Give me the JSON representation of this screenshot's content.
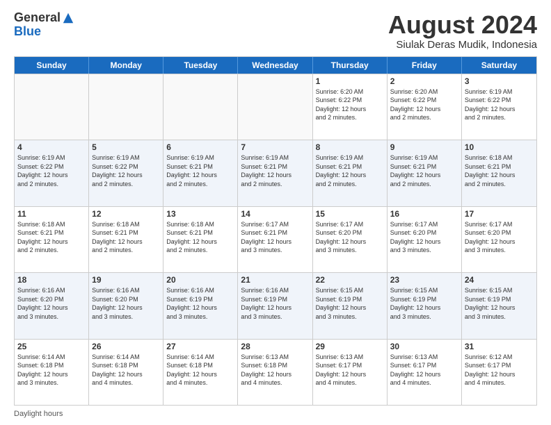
{
  "logo": {
    "general": "General",
    "blue": "Blue"
  },
  "title": "August 2024",
  "subtitle": "Siulak Deras Mudik, Indonesia",
  "days": [
    "Sunday",
    "Monday",
    "Tuesday",
    "Wednesday",
    "Thursday",
    "Friday",
    "Saturday"
  ],
  "footer": "Daylight hours",
  "weeks": [
    [
      {
        "day": "",
        "info": ""
      },
      {
        "day": "",
        "info": ""
      },
      {
        "day": "",
        "info": ""
      },
      {
        "day": "",
        "info": ""
      },
      {
        "day": "1",
        "info": "Sunrise: 6:20 AM\nSunset: 6:22 PM\nDaylight: 12 hours\nand 2 minutes."
      },
      {
        "day": "2",
        "info": "Sunrise: 6:20 AM\nSunset: 6:22 PM\nDaylight: 12 hours\nand 2 minutes."
      },
      {
        "day": "3",
        "info": "Sunrise: 6:19 AM\nSunset: 6:22 PM\nDaylight: 12 hours\nand 2 minutes."
      }
    ],
    [
      {
        "day": "4",
        "info": "Sunrise: 6:19 AM\nSunset: 6:22 PM\nDaylight: 12 hours\nand 2 minutes."
      },
      {
        "day": "5",
        "info": "Sunrise: 6:19 AM\nSunset: 6:22 PM\nDaylight: 12 hours\nand 2 minutes."
      },
      {
        "day": "6",
        "info": "Sunrise: 6:19 AM\nSunset: 6:21 PM\nDaylight: 12 hours\nand 2 minutes."
      },
      {
        "day": "7",
        "info": "Sunrise: 6:19 AM\nSunset: 6:21 PM\nDaylight: 12 hours\nand 2 minutes."
      },
      {
        "day": "8",
        "info": "Sunrise: 6:19 AM\nSunset: 6:21 PM\nDaylight: 12 hours\nand 2 minutes."
      },
      {
        "day": "9",
        "info": "Sunrise: 6:19 AM\nSunset: 6:21 PM\nDaylight: 12 hours\nand 2 minutes."
      },
      {
        "day": "10",
        "info": "Sunrise: 6:18 AM\nSunset: 6:21 PM\nDaylight: 12 hours\nand 2 minutes."
      }
    ],
    [
      {
        "day": "11",
        "info": "Sunrise: 6:18 AM\nSunset: 6:21 PM\nDaylight: 12 hours\nand 2 minutes."
      },
      {
        "day": "12",
        "info": "Sunrise: 6:18 AM\nSunset: 6:21 PM\nDaylight: 12 hours\nand 2 minutes."
      },
      {
        "day": "13",
        "info": "Sunrise: 6:18 AM\nSunset: 6:21 PM\nDaylight: 12 hours\nand 2 minutes."
      },
      {
        "day": "14",
        "info": "Sunrise: 6:17 AM\nSunset: 6:21 PM\nDaylight: 12 hours\nand 3 minutes."
      },
      {
        "day": "15",
        "info": "Sunrise: 6:17 AM\nSunset: 6:20 PM\nDaylight: 12 hours\nand 3 minutes."
      },
      {
        "day": "16",
        "info": "Sunrise: 6:17 AM\nSunset: 6:20 PM\nDaylight: 12 hours\nand 3 minutes."
      },
      {
        "day": "17",
        "info": "Sunrise: 6:17 AM\nSunset: 6:20 PM\nDaylight: 12 hours\nand 3 minutes."
      }
    ],
    [
      {
        "day": "18",
        "info": "Sunrise: 6:16 AM\nSunset: 6:20 PM\nDaylight: 12 hours\nand 3 minutes."
      },
      {
        "day": "19",
        "info": "Sunrise: 6:16 AM\nSunset: 6:20 PM\nDaylight: 12 hours\nand 3 minutes."
      },
      {
        "day": "20",
        "info": "Sunrise: 6:16 AM\nSunset: 6:19 PM\nDaylight: 12 hours\nand 3 minutes."
      },
      {
        "day": "21",
        "info": "Sunrise: 6:16 AM\nSunset: 6:19 PM\nDaylight: 12 hours\nand 3 minutes."
      },
      {
        "day": "22",
        "info": "Sunrise: 6:15 AM\nSunset: 6:19 PM\nDaylight: 12 hours\nand 3 minutes."
      },
      {
        "day": "23",
        "info": "Sunrise: 6:15 AM\nSunset: 6:19 PM\nDaylight: 12 hours\nand 3 minutes."
      },
      {
        "day": "24",
        "info": "Sunrise: 6:15 AM\nSunset: 6:19 PM\nDaylight: 12 hours\nand 3 minutes."
      }
    ],
    [
      {
        "day": "25",
        "info": "Sunrise: 6:14 AM\nSunset: 6:18 PM\nDaylight: 12 hours\nand 3 minutes."
      },
      {
        "day": "26",
        "info": "Sunrise: 6:14 AM\nSunset: 6:18 PM\nDaylight: 12 hours\nand 4 minutes."
      },
      {
        "day": "27",
        "info": "Sunrise: 6:14 AM\nSunset: 6:18 PM\nDaylight: 12 hours\nand 4 minutes."
      },
      {
        "day": "28",
        "info": "Sunrise: 6:13 AM\nSunset: 6:18 PM\nDaylight: 12 hours\nand 4 minutes."
      },
      {
        "day": "29",
        "info": "Sunrise: 6:13 AM\nSunset: 6:17 PM\nDaylight: 12 hours\nand 4 minutes."
      },
      {
        "day": "30",
        "info": "Sunrise: 6:13 AM\nSunset: 6:17 PM\nDaylight: 12 hours\nand 4 minutes."
      },
      {
        "day": "31",
        "info": "Sunrise: 6:12 AM\nSunset: 6:17 PM\nDaylight: 12 hours\nand 4 minutes."
      }
    ]
  ]
}
